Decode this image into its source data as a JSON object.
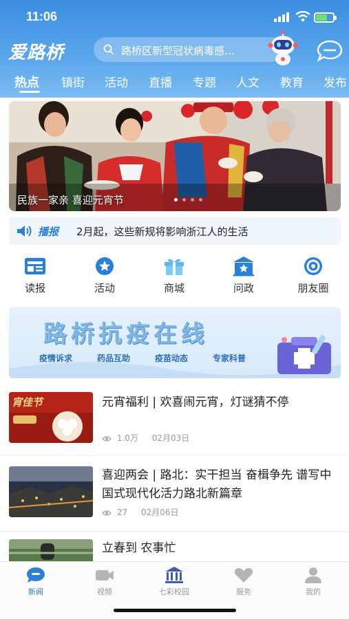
{
  "status_bar": {
    "time": "11:06"
  },
  "header": {
    "logo_text": "爱路桥",
    "search_placeholder": "路桥区新型冠状病毒感…",
    "icons": {
      "search": "search-icon",
      "assistant": "robot-assistant-icon",
      "message": "chat-bubble-icon"
    }
  },
  "nav_tabs": [
    {
      "label": "热点",
      "active": true
    },
    {
      "label": "镇街"
    },
    {
      "label": "活动"
    },
    {
      "label": "直播"
    },
    {
      "label": "专题"
    },
    {
      "label": "人文"
    },
    {
      "label": "教育"
    },
    {
      "label": "发布"
    }
  ],
  "banner": {
    "caption": "民族一家亲 喜迎元宵节"
  },
  "bulletin": {
    "tag": "播报",
    "text": "2月起，这些新规将影响浙江人的生活"
  },
  "quick_actions": [
    {
      "label": "读报",
      "icon": "newspaper-icon"
    },
    {
      "label": "活动",
      "icon": "star-badge-icon"
    },
    {
      "label": "商城",
      "icon": "gift-icon"
    },
    {
      "label": "问政",
      "icon": "government-building-icon"
    },
    {
      "label": "朋友圈",
      "icon": "circle-friends-icon"
    }
  ],
  "promo": {
    "title": "路桥抗疫在线",
    "items": [
      "疫情诉求",
      "药品互助",
      "疫苗动态",
      "专家科普"
    ]
  },
  "articles": [
    {
      "title": "元宵福利 | 欢喜闹元宵，灯谜猜不停",
      "views": "1.0万",
      "date": "02月03日",
      "thumb_text": "宵佳节"
    },
    {
      "title": "喜迎两会 | 路北：实干担当 奋楫争先 谱写中国式现代化活力路北新篇章",
      "views": "27",
      "date": "02月06日"
    },
    {
      "title": "立春到 农事忙"
    }
  ],
  "tab_bar": [
    {
      "label": "新闻",
      "icon": "news-chat-icon",
      "active": true
    },
    {
      "label": "视频",
      "icon": "video-camera-icon"
    },
    {
      "label": "七彩校园",
      "icon": "campus-building-icon"
    },
    {
      "label": "服务",
      "icon": "heart-service-icon"
    },
    {
      "label": "我的",
      "icon": "user-profile-icon"
    }
  ],
  "colors": {
    "primary": "#3b8fe0",
    "accent_blue": "#2a7fd6",
    "active_tab": "#2a7fd6"
  }
}
